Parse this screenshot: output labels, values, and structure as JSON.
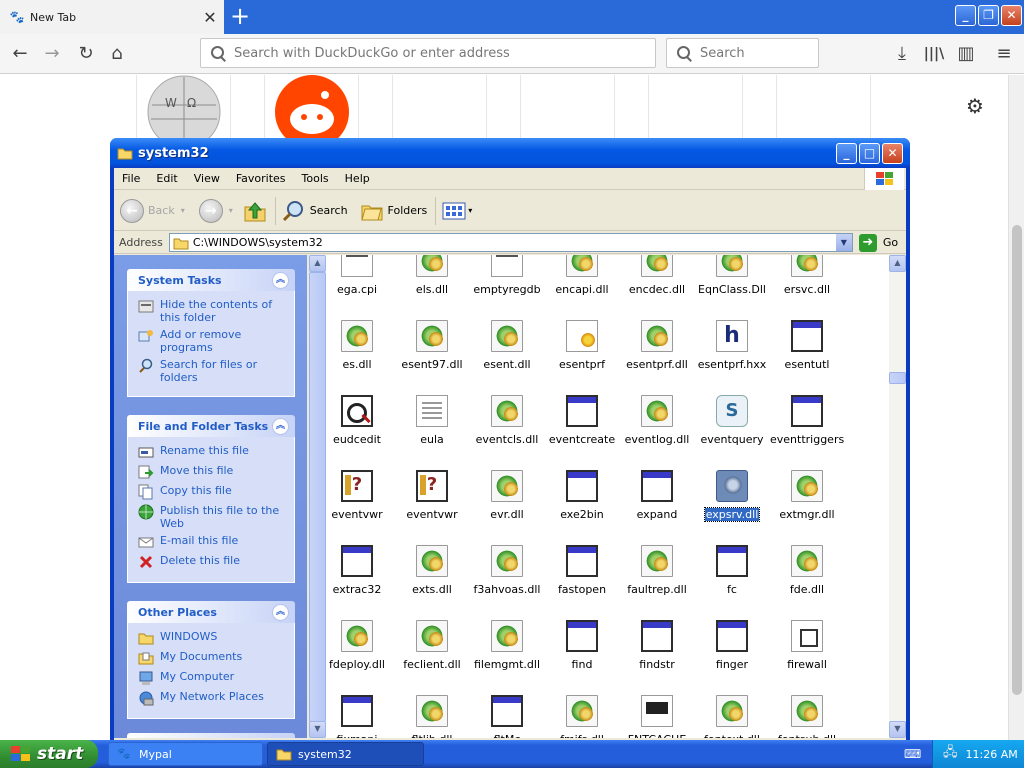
{
  "browser": {
    "tab": {
      "title": "New Tab"
    },
    "url_placeholder": "Search with DuckDuckGo or enter address",
    "search_placeholder": "Search"
  },
  "explorer": {
    "title": "system32",
    "menu": [
      "File",
      "Edit",
      "View",
      "Favorites",
      "Tools",
      "Help"
    ],
    "toolbar": {
      "back": "Back",
      "search": "Search",
      "folders": "Folders"
    },
    "address_label": "Address",
    "address_value": "C:\\WINDOWS\\system32",
    "go_label": "Go",
    "panels": {
      "system_tasks": {
        "title": "System Tasks",
        "items": [
          "Hide the contents of this folder",
          "Add or remove programs",
          "Search for files or folders"
        ]
      },
      "file_tasks": {
        "title": "File and Folder Tasks",
        "items": [
          "Rename this file",
          "Move this file",
          "Copy this file",
          "Publish this file to the Web",
          "E-mail this file",
          "Delete this file"
        ]
      },
      "other_places": {
        "title": "Other Places",
        "items": [
          "WINDOWS",
          "My Documents",
          "My Computer",
          "My Network Places"
        ]
      }
    },
    "files": [
      {
        "name": "ega.cpi",
        "icon": "cpi"
      },
      {
        "name": "els.dll",
        "icon": "dll"
      },
      {
        "name": "emptyregdb",
        "icon": "cpi"
      },
      {
        "name": "encapi.dll",
        "icon": "dll"
      },
      {
        "name": "encdec.dll",
        "icon": "dll"
      },
      {
        "name": "EqnClass.Dll",
        "icon": "dll"
      },
      {
        "name": "ersvc.dll",
        "icon": "dll"
      },
      {
        "name": "es.dll",
        "icon": "dll"
      },
      {
        "name": "esent97.dll",
        "icon": "dll"
      },
      {
        "name": "esent.dll",
        "icon": "dll"
      },
      {
        "name": "esentprf",
        "icon": "prf"
      },
      {
        "name": "esentprf.dll",
        "icon": "dll"
      },
      {
        "name": "esentprf.hxx",
        "icon": "h"
      },
      {
        "name": "esentutl",
        "icon": "exe"
      },
      {
        "name": "eudcedit",
        "icon": "edit"
      },
      {
        "name": "eula",
        "icon": "doc"
      },
      {
        "name": "eventcls.dll",
        "icon": "dll"
      },
      {
        "name": "eventcreate",
        "icon": "exe"
      },
      {
        "name": "eventlog.dll",
        "icon": "dll"
      },
      {
        "name": "eventquery",
        "icon": "script"
      },
      {
        "name": "eventtriggers",
        "icon": "exe"
      },
      {
        "name": "eventvwr",
        "icon": "msc"
      },
      {
        "name": "eventvwr",
        "icon": "msc"
      },
      {
        "name": "evr.dll",
        "icon": "dll"
      },
      {
        "name": "exe2bin",
        "icon": "exe"
      },
      {
        "name": "expand",
        "icon": "exe"
      },
      {
        "name": "expsrv.dll",
        "icon": "selgear",
        "selected": true
      },
      {
        "name": "extmgr.dll",
        "icon": "dll"
      },
      {
        "name": "extrac32",
        "icon": "exe"
      },
      {
        "name": "exts.dll",
        "icon": "dll"
      },
      {
        "name": "f3ahvoas.dll",
        "icon": "dll"
      },
      {
        "name": "fastopen",
        "icon": "exe"
      },
      {
        "name": "faultrep.dll",
        "icon": "dll"
      },
      {
        "name": "fc",
        "icon": "exe"
      },
      {
        "name": "fde.dll",
        "icon": "dll"
      },
      {
        "name": "fdeploy.dll",
        "icon": "dll"
      },
      {
        "name": "feclient.dll",
        "icon": "dll"
      },
      {
        "name": "filemgmt.dll",
        "icon": "dll"
      },
      {
        "name": "find",
        "icon": "exe"
      },
      {
        "name": "findstr",
        "icon": "exe"
      },
      {
        "name": "finger",
        "icon": "exe"
      },
      {
        "name": "firewall",
        "icon": "sys"
      },
      {
        "name": "fixmapi",
        "icon": "exe"
      },
      {
        "name": "fltlib.dll",
        "icon": "dll"
      },
      {
        "name": "fltMc",
        "icon": "exe"
      },
      {
        "name": "fmifs.dll",
        "icon": "dll"
      },
      {
        "name": "FNTCACHE",
        "icon": "font"
      },
      {
        "name": "fontext.dll",
        "icon": "dll"
      },
      {
        "name": "fontsub.dll",
        "icon": "dll"
      }
    ]
  },
  "taskbar": {
    "start_label": "start",
    "tasks": [
      "Mypal",
      "system32"
    ],
    "clock": "11:26 AM"
  },
  "colors": {
    "xp_blue": "#0a3cc2",
    "firefox_tabbar": "#2a6ad8",
    "taskpane_link": "#215dc6",
    "start_green": "#318d31",
    "selection": "#316ac5"
  }
}
